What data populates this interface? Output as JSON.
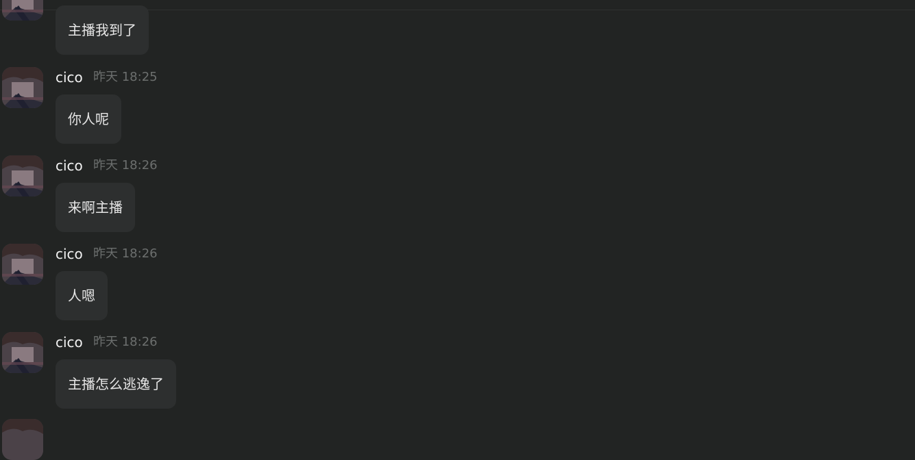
{
  "messages": [
    {
      "user": "",
      "time": "",
      "text": "主播我到了"
    },
    {
      "user": "cico",
      "time": "昨天 18:25",
      "text": "你人呢"
    },
    {
      "user": "cico",
      "time": "昨天 18:26",
      "text": "来啊主播"
    },
    {
      "user": "cico",
      "time": "昨天 18:26",
      "text": "人嗯"
    },
    {
      "user": "cico",
      "time": "昨天 18:26",
      "text": "主播怎么逃逸了"
    }
  ],
  "colors": {
    "background": "#222423",
    "bubble": "#2d2f2f",
    "username": "#f2f2f2",
    "timestamp": "#6c6f6e",
    "message_text": "#e6e6e6"
  }
}
